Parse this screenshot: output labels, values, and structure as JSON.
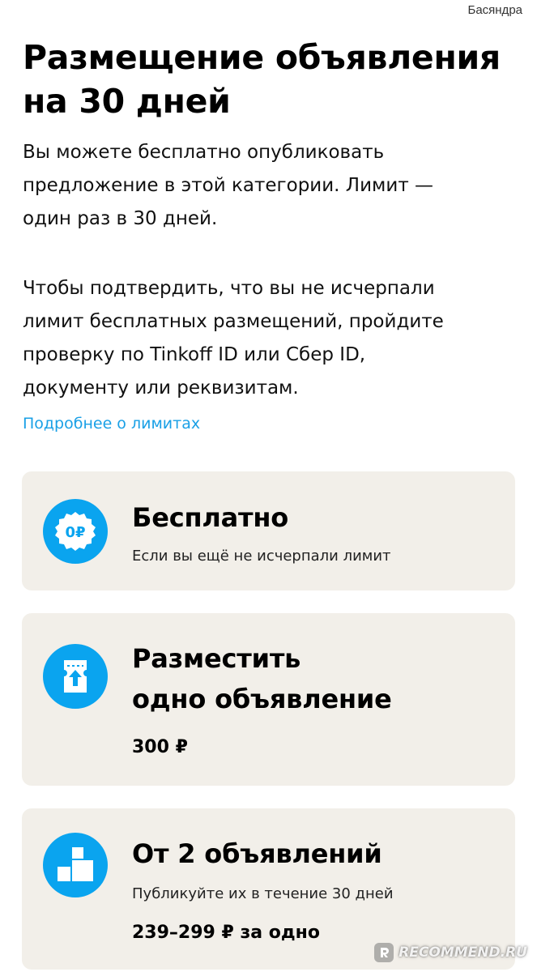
{
  "header": {
    "username": "Басяндра"
  },
  "main": {
    "title_lines": [
      "Размещение объявления",
      "на 30 дней"
    ],
    "paragraph1_lines": [
      "Вы можете бесплатно опубликовать",
      "предложение в этой категории. Лимит —",
      "один раз в 30 дней."
    ],
    "paragraph2_lines": [
      "Чтобы подтвердить, что вы не исчерпали",
      "лимит бесплатных размещений, пройдите",
      "проверку по Tinkoff ID или Сбер ID,",
      "документу или реквизитам."
    ],
    "limits_link": "Подробнее о лимитах"
  },
  "options": {
    "free": {
      "title": "Бесплатно",
      "subtitle": "Если вы ещё не исчерпали лимит",
      "icon_text": "0₽",
      "icon": "zero-ruble-badge-icon"
    },
    "single": {
      "title_lines": [
        "Разместить",
        "одно объявление"
      ],
      "price": "300 ₽",
      "icon": "ticket-upload-icon"
    },
    "multi": {
      "title": "От 2 объявлений",
      "subtitle": "Публикуйте их в течение 30 дней",
      "price": "239–299 ₽ за одно",
      "icon": "boxes-icon"
    }
  },
  "watermark": {
    "text": "RECOMMEND.RU"
  },
  "colors": {
    "accent": "#0aa4ef",
    "link": "#1aa0e6",
    "card_bg": "#f2efe9"
  }
}
